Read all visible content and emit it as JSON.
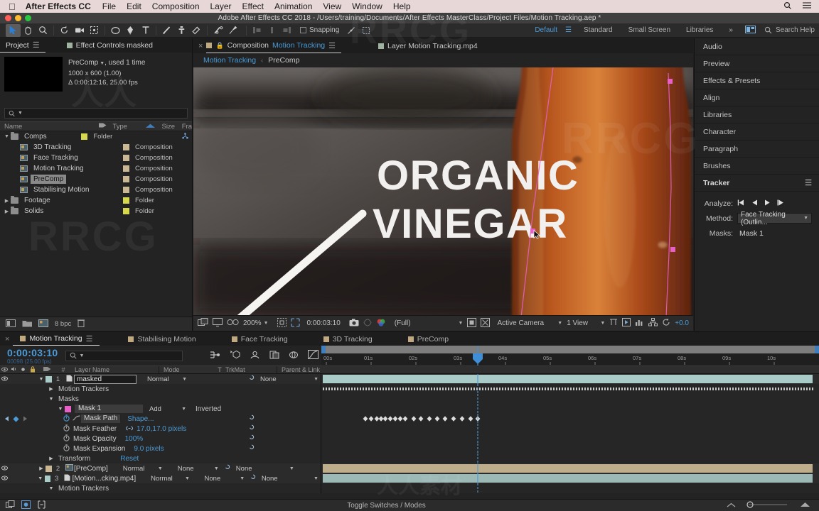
{
  "menubar": {
    "apple": "apple-logo",
    "app": "After Effects CC",
    "items": [
      "File",
      "Edit",
      "Composition",
      "Layer",
      "Effect",
      "Animation",
      "View",
      "Window",
      "Help"
    ]
  },
  "titlebar": {
    "title": "Adobe After Effects CC 2018 - /Users/training/Documents/After Effects MasterClass/Project Files/Motion Tracking.aep *"
  },
  "toolbar": {
    "snapping_label": "Snapping",
    "workspaces": [
      "Default",
      "Standard",
      "Small Screen",
      "Libraries"
    ],
    "workspace_active": "Default",
    "overflow": "»",
    "search_help": "Search Help"
  },
  "project": {
    "tab_label": "Project",
    "effect_controls_tab": "Effect Controls masked",
    "item_title": "PreComp",
    "item_used": ", used 1 time",
    "item_size": "1000 x 600 (1.00)",
    "item_duration": "Δ 0:00:12:16, 25.00 fps",
    "search_placeholder": "",
    "columns": [
      "Name",
      "Type",
      "Size",
      "Fra"
    ],
    "rows": [
      {
        "label": "Comps",
        "type": "Folder",
        "kind": "folder",
        "depth": 0,
        "twirl": "▼",
        "selected": false,
        "swatch": "#d8d84e"
      },
      {
        "label": "3D Tracking",
        "type": "Composition",
        "kind": "comp",
        "depth": 1,
        "twirl": "",
        "selected": false,
        "swatch": "#c9b893"
      },
      {
        "label": "Face Tracking",
        "type": "Composition",
        "kind": "comp",
        "depth": 1,
        "twirl": "",
        "selected": false,
        "swatch": "#c9b893"
      },
      {
        "label": "Motion Tracking",
        "type": "Composition",
        "kind": "comp",
        "depth": 1,
        "twirl": "",
        "selected": false,
        "swatch": "#c9b893"
      },
      {
        "label": "PreComp",
        "type": "Composition",
        "kind": "comp",
        "depth": 1,
        "twirl": "",
        "selected": true,
        "swatch": "#c9b893"
      },
      {
        "label": "Stabilising Motion",
        "type": "Composition",
        "kind": "comp",
        "depth": 1,
        "twirl": "",
        "selected": false,
        "swatch": "#c9b893"
      },
      {
        "label": "Footage",
        "type": "Folder",
        "kind": "folder",
        "depth": 0,
        "twirl": "▶",
        "selected": false,
        "swatch": "#d8d84e"
      },
      {
        "label": "Solids",
        "type": "Folder",
        "kind": "folder",
        "depth": 0,
        "twirl": "▶",
        "selected": false,
        "swatch": "#d8d84e"
      }
    ],
    "footer_bpc": "8 bpc"
  },
  "composition": {
    "tab_prefix": "Composition",
    "tab_name": "Motion Tracking",
    "layer_tab": "Layer Motion Tracking.mp4",
    "breadcrumb_current": "Motion Tracking",
    "breadcrumb_next": "PreComp",
    "viewer_text_line1": "ORGANIC",
    "viewer_text_line2": "VINEGAR",
    "toolbar": {
      "zoom": "200%",
      "timecode": "0:00:03:10",
      "resolution": "(Full)",
      "view": "Active Camera",
      "views": "1 View",
      "exposure": "+0.0"
    }
  },
  "rightdock": {
    "panels": [
      "Audio",
      "Preview",
      "Effects & Presets",
      "Align",
      "Libraries",
      "Character",
      "Paragraph",
      "Brushes"
    ],
    "tracker": {
      "title": "Tracker",
      "analyze_label": "Analyze:",
      "analyze_buttons": [
        "analyze-1-back-icon",
        "analyze-back-icon",
        "analyze-forward-icon",
        "analyze-1-forward-icon"
      ],
      "method_label": "Method:",
      "method_value": "Face Tracking (Outlin...",
      "masks_label": "Masks:",
      "masks_value": "Mask 1"
    }
  },
  "timeline": {
    "tabs": [
      "Motion Tracking",
      "Stabilising Motion",
      "Face Tracking",
      "3D Tracking",
      "PreComp"
    ],
    "tab_active": "Motion Tracking",
    "timecode": "0:00:03:10",
    "frames": "00098 (25.00 fps)",
    "search_placeholder": "",
    "columns": [
      "Layer Name",
      "Mode",
      "T",
      "TrkMat",
      "Parent & Link"
    ],
    "ruler_ticks": [
      "00s",
      "01s",
      "02s",
      "03s",
      "04s",
      "05s",
      "06s",
      "07s",
      "08s",
      "09s",
      "10s"
    ],
    "playhead_time": "0:00:03:10",
    "rows": [
      {
        "type": "layer",
        "num": "1",
        "name": "masked",
        "mode": "Normal",
        "trkmat": "",
        "parent": "None",
        "color": "#a9ccc9",
        "selected": true,
        "editing": true,
        "twirl": "▼",
        "depth": 0
      },
      {
        "type": "group",
        "name": "Motion Trackers",
        "twirl": "▶",
        "depth": 1
      },
      {
        "type": "group",
        "name": "Masks",
        "twirl": "▼",
        "depth": 1
      },
      {
        "type": "mask",
        "name": "Mask 1",
        "mode": "Add",
        "extra": "Inverted",
        "color": "#e85fc8",
        "twirl": "▼",
        "depth": 2
      },
      {
        "type": "prop",
        "name": "Mask Path",
        "value": "Shape...",
        "depth": 3,
        "stopwatch": "on",
        "keyframed": true
      },
      {
        "type": "prop",
        "name": "Mask Feather",
        "value": "17.0,17.0 pixels",
        "depth": 3,
        "link": true
      },
      {
        "type": "prop",
        "name": "Mask Opacity",
        "value": "100%",
        "depth": 3
      },
      {
        "type": "prop",
        "name": "Mask Expansion",
        "value": "9.0 pixels",
        "depth": 3
      },
      {
        "type": "group",
        "name": "Transform",
        "value": "Reset",
        "twirl": "▶",
        "depth": 1
      },
      {
        "type": "layer",
        "num": "2",
        "name": "[PreComp]",
        "mode": "Normal",
        "trkmat": "None",
        "parent": "None",
        "color": "#c9b893",
        "twirl": "▶",
        "depth": 0
      },
      {
        "type": "layer",
        "num": "3",
        "name": "[Motion...cking.mp4]",
        "mode": "Normal",
        "trkmat": "None",
        "parent": "None",
        "color": "#a9ccc9",
        "twirl": "▼",
        "depth": 0
      },
      {
        "type": "group",
        "name": "Motion Trackers",
        "twirl": "▼",
        "depth": 1
      }
    ],
    "status_label": "Toggle Switches / Modes"
  },
  "colors": {
    "accent_blue": "#4a9bd8",
    "mask_pink": "#e85fc8",
    "panel_bg": "#232323",
    "toolbar_bg": "#2b2b2b",
    "menubar_bg": "#e8d7d7",
    "layer_teal": "#a9ccc9",
    "layer_tan": "#c9b893"
  },
  "watermarks": [
    "RRCG",
    "人人素材"
  ]
}
